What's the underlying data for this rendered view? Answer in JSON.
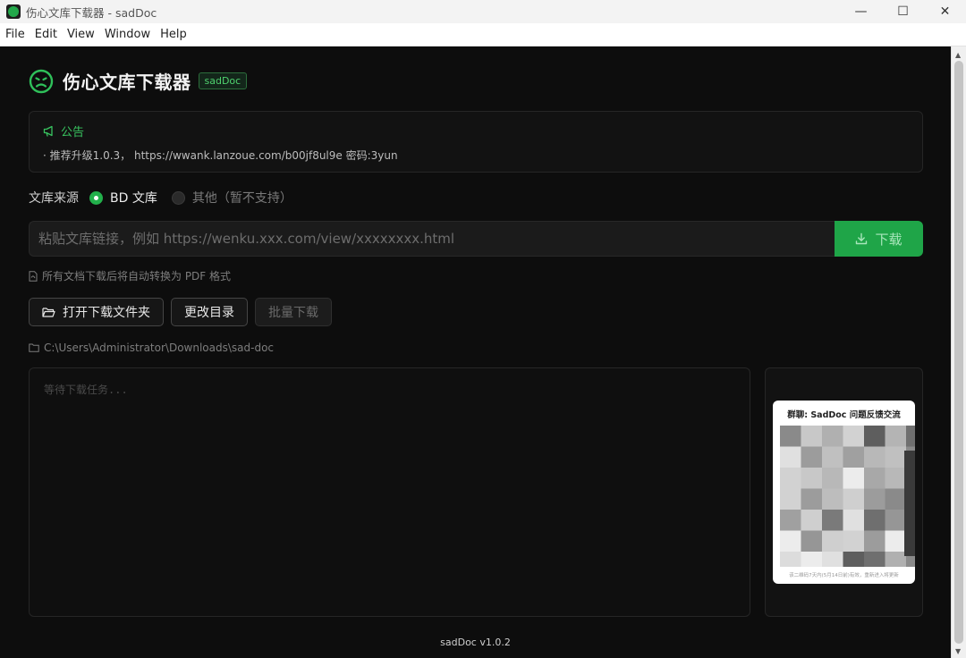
{
  "window": {
    "title": "伤心文库下载器 - sadDoc",
    "minimize": "—",
    "maximize": "☐",
    "close": "✕"
  },
  "menu": [
    "File",
    "Edit",
    "View",
    "Window",
    "Help"
  ],
  "app": {
    "name": "伤心文库下载器",
    "tag": "sadDoc"
  },
  "notice": {
    "title": "公告",
    "text": "· 推荐升级1.0.3， https://wwank.lanzoue.com/b00jf8ul9e 密码:3yun"
  },
  "source": {
    "label": "文库来源",
    "options": [
      {
        "label": "BD 文库",
        "selected": true
      },
      {
        "label": "其他（暂不支持）",
        "selected": false
      }
    ]
  },
  "url_input": {
    "placeholder": "粘贴文库链接，例如 https://wenku.xxx.com/view/xxxxxxxx.html",
    "value": ""
  },
  "download_button": "下载",
  "hint": "所有文档下载后将自动转换为 PDF 格式",
  "buttons": {
    "open_folder": "打开下载文件夹",
    "change_dir": "更改目录",
    "batch_download": "批量下载"
  },
  "download_path": "C:\\Users\\Administrator\\Downloads\\sad-doc",
  "log_placeholder": "等待下载任务...",
  "qr": {
    "title": "群聊: SadDoc 问题反馈交流",
    "caption": "该二维码7天内(5月14日前)有效，重新进入将更新"
  },
  "version": "sadDoc v1.0.2",
  "colors": {
    "accent": "#22b04b",
    "background": "#0d0d0d"
  }
}
